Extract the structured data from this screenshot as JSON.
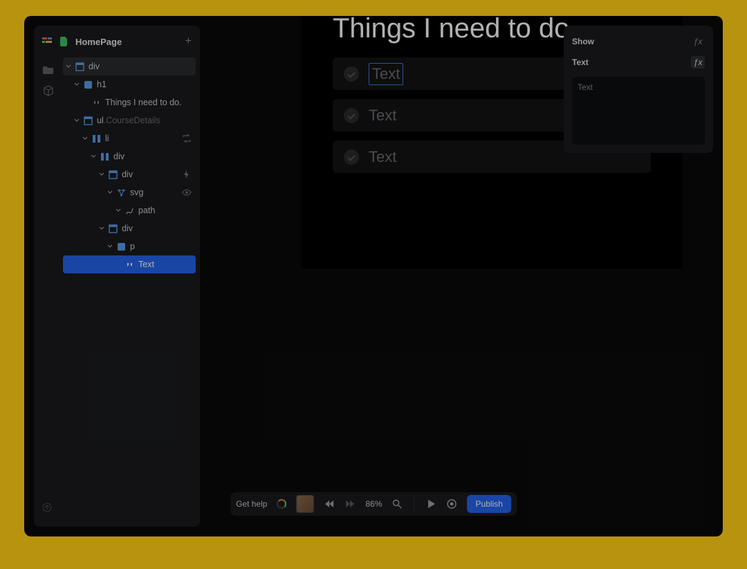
{
  "header": {
    "page_name": "HomePage"
  },
  "tree": {
    "root": {
      "label": "div"
    },
    "h1": {
      "label": "h1"
    },
    "h1_text": {
      "label": "Things I need to do."
    },
    "ul": {
      "label": "ul",
      "suffix": ".CourseDetails"
    },
    "li": {
      "label": "li"
    },
    "div1": {
      "label": "div"
    },
    "div2": {
      "label": "div"
    },
    "svg": {
      "label": "svg"
    },
    "path": {
      "label": "path"
    },
    "div3": {
      "label": "div"
    },
    "p": {
      "label": "p"
    },
    "text_node": {
      "label": "Text"
    }
  },
  "canvas": {
    "title": "Things I need to do.",
    "items": [
      {
        "text": "Text",
        "editing": true
      },
      {
        "text": "Text",
        "editing": false
      },
      {
        "text": "Text",
        "editing": false
      }
    ]
  },
  "inspector": {
    "show_label": "Show",
    "text_label": "Text",
    "text_value": "Text"
  },
  "bottombar": {
    "help": "Get help",
    "zoom": "86%",
    "publish": "Publish"
  }
}
